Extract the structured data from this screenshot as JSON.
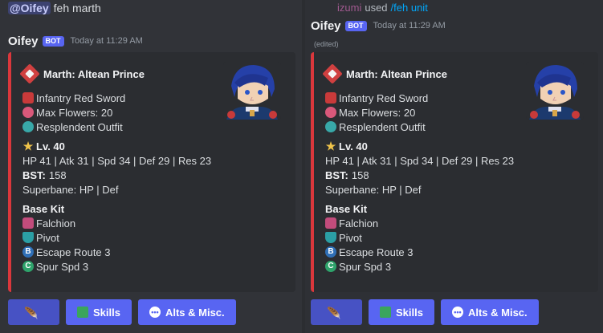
{
  "left": {
    "command": {
      "mention": "@Oifey",
      "text": "feh marth"
    },
    "message": {
      "username": "Oifey",
      "bot_badge": "BOT",
      "timestamp": "Today at 11:29 AM"
    }
  },
  "right": {
    "reply": {
      "user": "izumi",
      "used": "used",
      "command": "/feh unit"
    },
    "message": {
      "username": "Oifey",
      "bot_badge": "BOT",
      "timestamp": "Today at 11:29 AM",
      "edited": "(edited)"
    }
  },
  "embed": {
    "accent_color": "#da373c",
    "title": "Marth: Altean Prince",
    "lines": {
      "weapon_type": "Infantry Red Sword",
      "flowers": "Max Flowers: 20",
      "outfit": "Resplendent Outfit",
      "level": "Lv. 40",
      "stats": "HP 41 | Atk 31 | Spd 34 | Def 29 | Res 23",
      "bst_label": "BST:",
      "bst_value": "158",
      "superbane": "Superbane: HP | Def",
      "base_kit_label": "Base Kit",
      "skill_weapon": "Falchion",
      "skill_assist": "Pivot",
      "skill_b": "Escape Route 3",
      "skill_c": "Spur Spd 3"
    }
  },
  "buttons": {
    "skills": "Skills",
    "alts": "Alts & Misc."
  },
  "icons": [
    "crest-icon",
    "red-sword-icon",
    "flower-icon",
    "outfit-icon",
    "star-icon",
    "sword-icon",
    "shield-icon",
    "b-skill-icon",
    "c-skill-icon",
    "feather-icon",
    "book-icon",
    "chat-icon"
  ]
}
